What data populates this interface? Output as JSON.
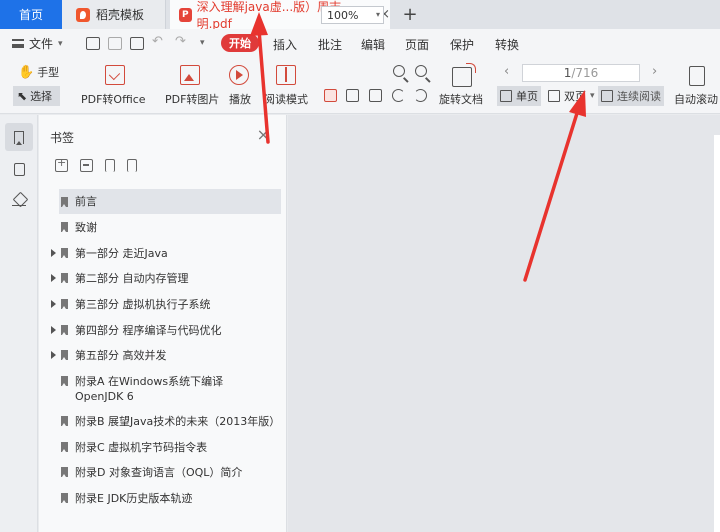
{
  "tabs": {
    "home": "首页",
    "template": "稻壳模板",
    "document": "深入理解java虚...版）周志明.pdf",
    "add": "+",
    "close": "×"
  },
  "menubar": {
    "file": "文件",
    "items": [
      "开始",
      "插入",
      "批注",
      "编辑",
      "页面",
      "保护",
      "转换"
    ]
  },
  "ribbon": {
    "hand": "手型",
    "select": "选择",
    "pdf_to_office": "PDF转Office",
    "pdf_to_image": "PDF转图片",
    "play": "播放",
    "read_mode": "阅读模式",
    "zoom": "100%",
    "rotate_doc": "旋转文档",
    "current_page": "1",
    "total_pages": "/716",
    "single_page": "单页",
    "double_page": "双页",
    "continuous": "连续阅读",
    "auto_scroll": "自动滚动"
  },
  "panel": {
    "title": "书签",
    "items": [
      {
        "label": "前言",
        "expandable": false
      },
      {
        "label": "致谢",
        "expandable": false
      },
      {
        "label": "第一部分 走近Java",
        "expandable": true
      },
      {
        "label": "第二部分 自动内存管理",
        "expandable": true
      },
      {
        "label": "第三部分 虚拟机执行子系统",
        "expandable": true
      },
      {
        "label": "第四部分 程序编译与代码优化",
        "expandable": true
      },
      {
        "label": "第五部分 高效并发",
        "expandable": true
      },
      {
        "label": "附录A 在Windows系统下编译OpenJDK 6",
        "expandable": false
      },
      {
        "label": "附录B 展望Java技术的未来（2013年版）",
        "expandable": false
      },
      {
        "label": "附录C 虚拟机字节码指令表",
        "expandable": false
      },
      {
        "label": "附录D 对象查询语言（OQL）简介",
        "expandable": false
      },
      {
        "label": "附录E JDK历史版本轨迹",
        "expandable": false
      }
    ]
  },
  "colors": {
    "accent": "#e03a3a",
    "home_tab": "#1e72e8",
    "annotation": "#e8332e"
  }
}
